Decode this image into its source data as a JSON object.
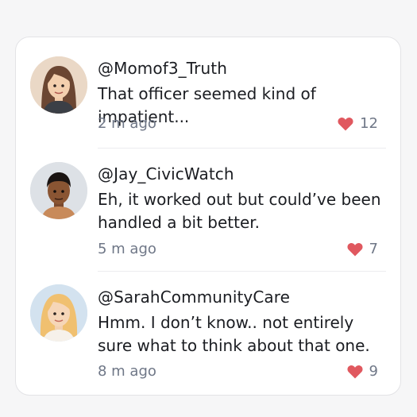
{
  "colors": {
    "heart": "#e0585f",
    "text": "#1b1d22",
    "muted": "#6f7787"
  },
  "comments": [
    {
      "username": "@Momof3_Truth",
      "text": "That officer seemed kind of impatient...",
      "time": "2 m ago",
      "likes": "12",
      "avatar": "woman-brown-hair-avatar"
    },
    {
      "username": "@Jay_CivicWatch",
      "text": "Eh, it worked out but could’ve been handled a bit better.",
      "time": "5 m ago",
      "likes": "7",
      "avatar": "man-dark-skin-avatar"
    },
    {
      "username": "@SarahCommunityCare",
      "text": "Hmm. I don’t know.. not entirely sure what to think about that one.",
      "time": "8 m ago",
      "likes": "9",
      "avatar": "woman-blonde-hair-avatar"
    }
  ]
}
